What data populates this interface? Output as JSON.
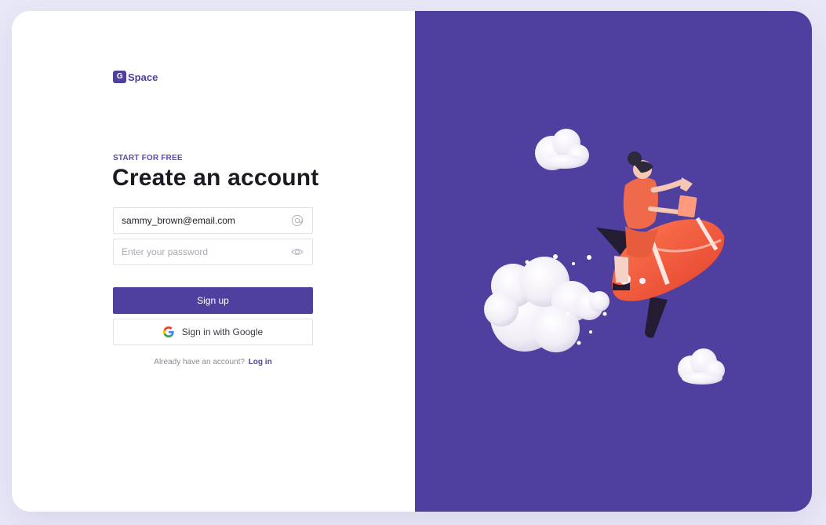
{
  "brand": {
    "logo_mark": "G",
    "logo_text": "Space"
  },
  "form": {
    "eyebrow": "START FOR FREE",
    "title": "Create an account",
    "email": {
      "value": "sammy_brown@email.com",
      "placeholder": "",
      "icon": "at-icon"
    },
    "password": {
      "value": "",
      "placeholder": "Enter your password",
      "icon": "eye-icon"
    },
    "signup_label": "Sign up",
    "google_label": "Sign in with Google",
    "login_prompt": "Already have an account?",
    "login_link": "Log in"
  },
  "colors": {
    "accent": "#4f3f9e",
    "page_bg": "#e9e8f6",
    "rocket": "#f0553a"
  }
}
